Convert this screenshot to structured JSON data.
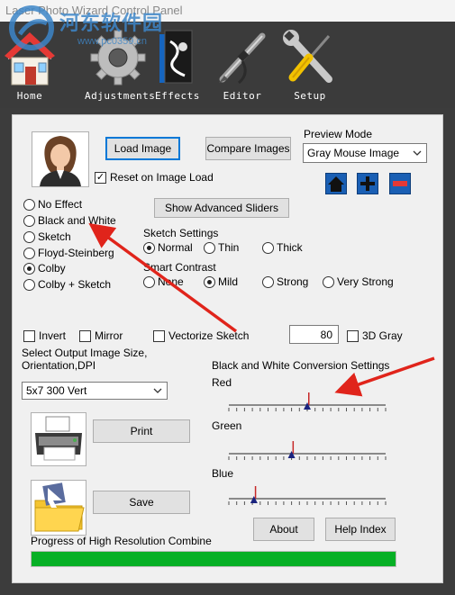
{
  "window": {
    "title": "Laser Photo Wizard Control Panel"
  },
  "watermark": {
    "text": "河东软件园",
    "url": "www.pc0359.cn"
  },
  "toolbar": {
    "items": [
      {
        "label": "Home",
        "icon": "house-icon"
      },
      {
        "label": "Adjustments",
        "icon": "gear-icon"
      },
      {
        "label": "Effects",
        "icon": "effects-icon"
      },
      {
        "label": "Editor",
        "icon": "airbrush-icon"
      },
      {
        "label": "Setup",
        "icon": "wrench-screwdriver-icon"
      }
    ]
  },
  "image": {
    "load_label": "Load Image",
    "compare_label": "Compare Images",
    "reset_label": "Reset on Image Load",
    "reset_checked": true
  },
  "preview": {
    "mode_label": "Preview Mode",
    "mode_value": "Gray Mouse Image",
    "buttons": [
      "home-icon",
      "plus-icon",
      "minus-icon"
    ]
  },
  "effects": {
    "options": [
      "No Effect",
      "Black and White",
      "Sketch",
      "Floyd-Steinberg",
      "Colby",
      "Colby + Sketch"
    ],
    "selected": "Colby"
  },
  "advanced_label": "Show Advanced Sliders",
  "sketch_settings": {
    "label": "Sketch Settings",
    "options": [
      "Normal",
      "Thin",
      "Thick"
    ],
    "selected": "Normal"
  },
  "smart_contrast": {
    "label": "Smart Contrast",
    "options": [
      "None",
      "Mild",
      "Strong",
      "Very Strong"
    ],
    "selected": "Mild"
  },
  "toggles": {
    "invert_label": "Invert",
    "mirror_label": "Mirror",
    "vectorize_label": "Vectorize Sketch",
    "gray_value": "80",
    "gray_label": "3D Gray"
  },
  "output": {
    "label": "Select Output Image Size, Orientation,DPI",
    "value": "5x7 300 Vert"
  },
  "bw_conversion": {
    "label": "Black and White Conversion Settings",
    "sliders": [
      {
        "name": "Red",
        "value": 0.5,
        "marker": 0.51
      },
      {
        "name": "Green",
        "value": 0.4,
        "marker": 0.41
      },
      {
        "name": "Blue",
        "value": 0.16,
        "marker": 0.17
      }
    ]
  },
  "actions": {
    "print_label": "Print",
    "save_label": "Save",
    "about_label": "About",
    "help_label": "Help Index"
  },
  "progress": {
    "label": "Progress of High Resolution Combine",
    "value": 1.0
  },
  "colors": {
    "accent_blue": "#1a5fb4",
    "progress_green": "#06b025",
    "annotation_red": "#e0241b"
  }
}
